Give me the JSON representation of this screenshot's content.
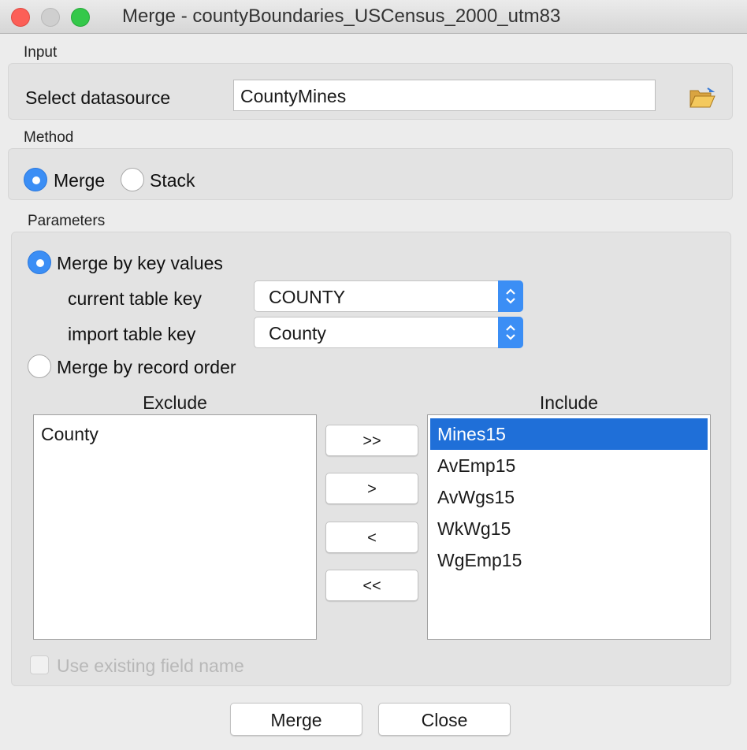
{
  "window": {
    "title": "Merge - countyBoundaries_USCensus_2000_utm83"
  },
  "input": {
    "section_label": "Input",
    "datasource_label": "Select datasource",
    "datasource_value": "CountyMines",
    "browse_icon": "folder-open-icon"
  },
  "method": {
    "section_label": "Method",
    "options": [
      {
        "label": "Merge",
        "selected": true
      },
      {
        "label": "Stack",
        "selected": false
      }
    ]
  },
  "parameters": {
    "section_label": "Parameters",
    "merge_by_key": {
      "label": "Merge by key values",
      "selected": true
    },
    "current_key_label": "current table key",
    "current_key_value": "COUNTY",
    "import_key_label": "import table key",
    "import_key_value": "County",
    "merge_by_order": {
      "label": "Merge by record order",
      "selected": false
    },
    "exclude": {
      "title": "Exclude",
      "items": [
        "County"
      ]
    },
    "include": {
      "title": "Include",
      "items": [
        "Mines15",
        "AvEmp15",
        "AvWgs15",
        "WkWg15",
        "WgEmp15"
      ],
      "selected_index": 0
    },
    "move_buttons": [
      ">>",
      ">",
      "<",
      "<<"
    ],
    "use_existing_label": "Use existing field name",
    "use_existing_checked": false
  },
  "buttons": {
    "merge": "Merge",
    "close": "Close"
  }
}
